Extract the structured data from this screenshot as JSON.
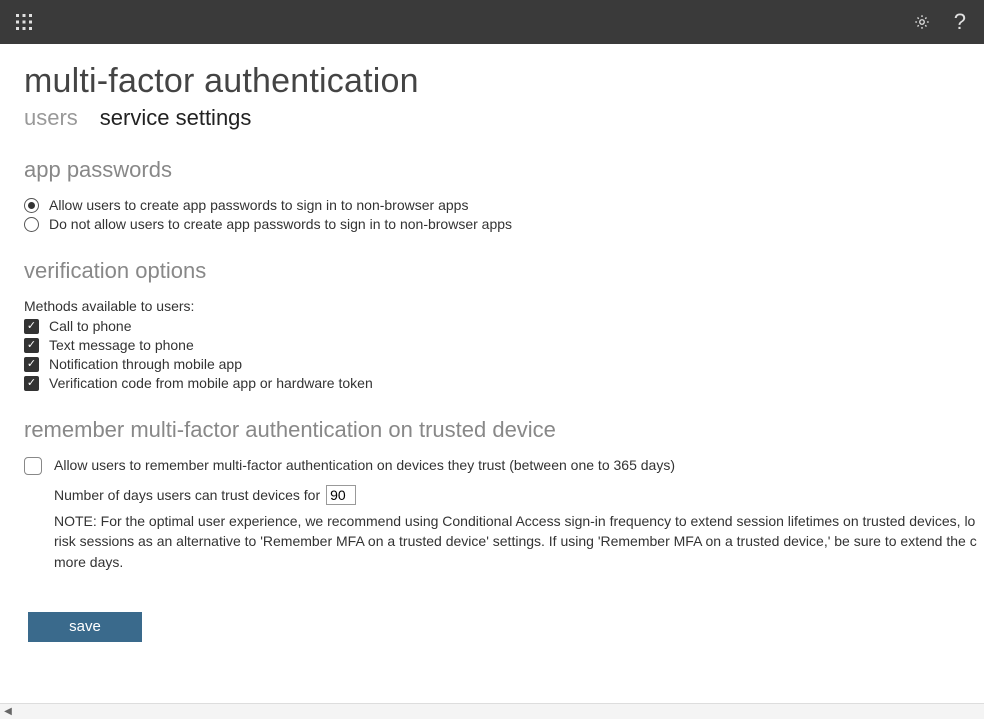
{
  "header": {
    "waffle_icon": "app-launcher",
    "settings_icon": "settings",
    "help_label": "?"
  },
  "page": {
    "title": "multi-factor authentication",
    "tabs": [
      "users",
      "service settings"
    ],
    "active_tab_index": 1
  },
  "sections": {
    "app_passwords": {
      "title": "app passwords",
      "options": [
        {
          "label": "Allow users to create app passwords to sign in to non-browser apps",
          "selected": true
        },
        {
          "label": "Do not allow users to create app passwords to sign in to non-browser apps",
          "selected": false
        }
      ]
    },
    "verification_options": {
      "title": "verification options",
      "methods_label": "Methods available to users:",
      "methods": [
        {
          "label": "Call to phone",
          "checked": true
        },
        {
          "label": "Text message to phone",
          "checked": true
        },
        {
          "label": "Notification through mobile app",
          "checked": true
        },
        {
          "label": "Verification code from mobile app or hardware token",
          "checked": true
        }
      ]
    },
    "remember": {
      "title": "remember multi-factor authentication on trusted device",
      "allow_label": "Allow users to remember multi-factor authentication on devices they trust (between one to 365 days)",
      "allow_checked": false,
      "days_label": "Number of days users can trust devices for",
      "days_value": "90",
      "note_line1": "NOTE: For the optimal user experience, we recommend using Conditional Access sign-in frequency to extend session lifetimes on trusted devices, lo",
      "note_line2": "risk sessions as an alternative to 'Remember MFA on a trusted device' settings. If using 'Remember MFA on a trusted device,' be sure to extend the c",
      "note_line3": "more days."
    }
  },
  "buttons": {
    "save": "save"
  }
}
